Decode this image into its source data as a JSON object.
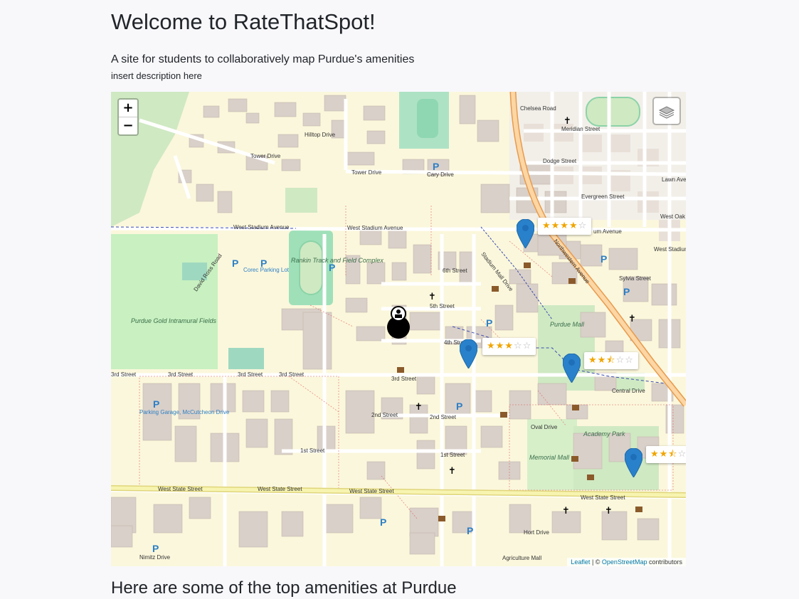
{
  "header": {
    "title": "Welcome to RateThatSpot!",
    "subtitle": "A site for students to collaboratively map Purdue's amenities",
    "description": "insert description here"
  },
  "map": {
    "zoom_in": "+",
    "zoom_out": "−",
    "layers_icon": "layers-icon",
    "attribution": {
      "leaflet": "Leaflet",
      "separator": " | © ",
      "osm": "OpenStreetMap",
      "contributors": " contributors"
    },
    "ratings": [
      {
        "stars": "★★★★",
        "empty": "☆"
      },
      {
        "stars": "★★★",
        "empty": "☆☆"
      },
      {
        "stars": "★★⯪",
        "empty": "☆☆"
      },
      {
        "stars": "★★⯪",
        "empty": "☆"
      }
    ],
    "street_labels": {
      "chelsea": "Chelsea Road",
      "meridian": "Meridian Street",
      "dodge": "Dodge Street",
      "evergreen": "Evergreen Street",
      "lawn": "Lawn Avenue",
      "west_oak": "West Oak",
      "west_stadium_1": "West Stadium Avenue",
      "west_stadium_2": "West Stadium Avenue",
      "um_avenue": "um Avenue",
      "west_stadium_3": "West Stadium",
      "sylvia": "Sylvia Street",
      "tower_drive_1": "Tower Drive",
      "tower_drive_2": "Tower Drive",
      "cary_drive": "Cary Drive",
      "hilltop": "Hilltop Drive",
      "david_ross": "David Ross Road",
      "fifth": "5th Street",
      "sixth": "6th Street",
      "fourth": "4th Street",
      "third_1": "3rd Street",
      "third_2": "3rd Street",
      "third_3": "3rd Street",
      "third_4": "3rd Street",
      "third_5": "3rd Street",
      "second_1": "2nd Street",
      "second_2": "2nd Street",
      "first": "1st Street",
      "oval": "Oval Drive",
      "central": "Central Drive",
      "west_state_1": "West State Street",
      "west_state_2": "West State Street",
      "west_state_3": "West State Street",
      "west_state_4": "West State Street",
      "hort": "Hort Drive",
      "agriculture": "Agriculture Mall",
      "nimitz": "Nimitz Drive",
      "northwestern": "Northwestern Avenue",
      "purdue_mall": "Purdue Mall",
      "stadium_mall": "Stadium Mall Drive",
      "memorial_mall": "Memorial Mall",
      "academy_park": "Academy Park",
      "intramural": "Purdue Gold Intramural Fields",
      "rankin": "Rankin Track and Field Complex",
      "corec": "Corec Parking Lot",
      "parking_garage": "Parking Garage, McCutcheon Drive"
    }
  },
  "section": {
    "heading": "Here are some of the top amenities at Purdue"
  }
}
